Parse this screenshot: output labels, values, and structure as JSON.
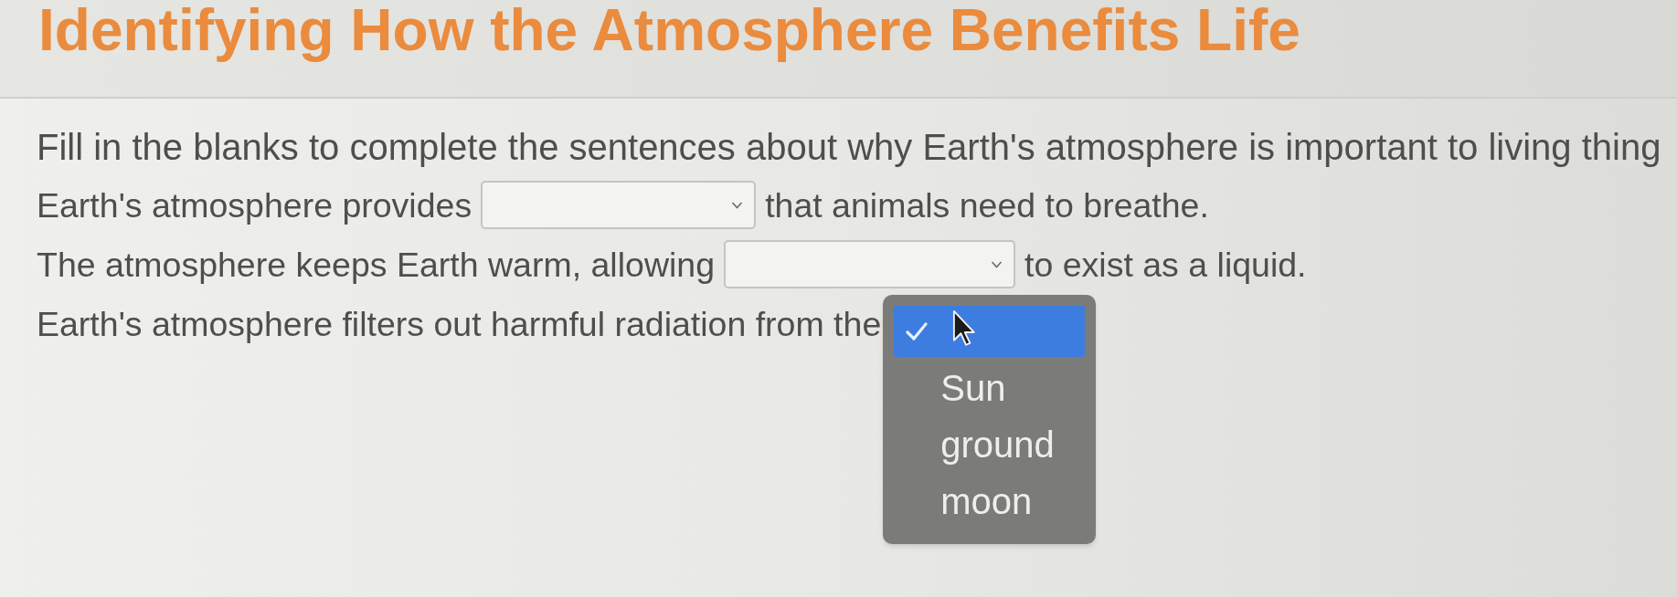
{
  "page": {
    "title": "Identifying How the Atmosphere Benefits Life"
  },
  "instructions": "Fill in the blanks to complete the sentences about why Earth's atmosphere is important to living thing",
  "sentences": [
    {
      "before": "Earth's atmosphere provides",
      "blank": {
        "open": false
      },
      "after": "that animals need to breathe."
    },
    {
      "before": "The atmosphere keeps Earth warm, allowing",
      "blank": {
        "open": false
      },
      "after": "to exist as a liquid."
    },
    {
      "before": "Earth's atmosphere filters out harmful radiation from the",
      "blank": {
        "open": true,
        "options": [
          {
            "kind": "blank",
            "selected": true,
            "highlighted": true
          },
          {
            "kind": "text",
            "label": "Sun",
            "selected": false,
            "highlighted": false
          },
          {
            "kind": "text",
            "label": "ground",
            "selected": false,
            "highlighted": false
          },
          {
            "kind": "text",
            "label": "moon",
            "selected": false,
            "highlighted": false
          }
        ]
      }
    }
  ]
}
